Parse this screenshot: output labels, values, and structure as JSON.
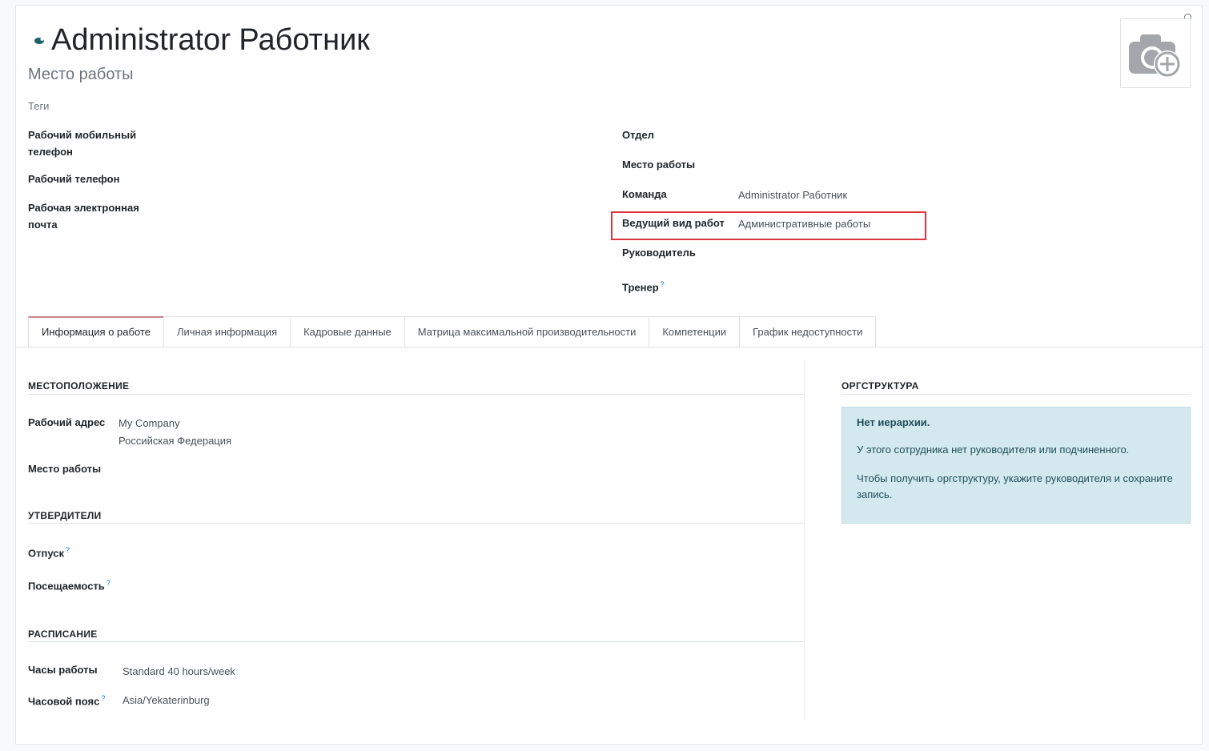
{
  "header": {
    "name": "Administrator Работник",
    "job_title_placeholder": "Место работы",
    "tags_placeholder": "Теги"
  },
  "left_fields": [
    {
      "label": "Рабочий мобильный телефон",
      "value": ""
    },
    {
      "label": "Рабочий телефон",
      "value": ""
    },
    {
      "label": "Рабочая электронная почта",
      "value": ""
    }
  ],
  "right_fields": {
    "department": {
      "label": "Отдел",
      "value": ""
    },
    "job_position": {
      "label": "Место работы",
      "value": ""
    },
    "team": {
      "label": "Команда",
      "value": "Administrator Работник"
    },
    "lead_activity": {
      "label": "Ведущий вид работ",
      "value": "Административные работы"
    },
    "manager": {
      "label": "Руководитель",
      "value": ""
    },
    "coach": {
      "label": "Тренер",
      "value": "",
      "help": "?"
    }
  },
  "tabs": [
    {
      "label": "Информация о работе",
      "active": true
    },
    {
      "label": "Личная информация",
      "active": false
    },
    {
      "label": "Кадровые данные",
      "active": false
    },
    {
      "label": "Матрица максимальной производительности",
      "active": false
    },
    {
      "label": "Компетенции",
      "active": false
    },
    {
      "label": "График недоступности",
      "active": false
    }
  ],
  "location_section": {
    "title": "МЕСТОПОЛОЖЕНИЕ",
    "work_address_label": "Рабочий адрес",
    "work_address_line1": "My Company",
    "work_address_line2": "Российская Федерация",
    "work_location_label": "Место работы"
  },
  "approvers_section": {
    "title": "УТВЕРДИТЕЛИ",
    "time_off_label": "Отпуск",
    "attendance_label": "Посещаемость",
    "help": "?"
  },
  "schedule_section": {
    "title": "РАСПИСАНИЕ",
    "working_hours_label": "Часы работы",
    "working_hours_value": "Standard 40 hours/week",
    "timezone_label": "Часовой пояс",
    "timezone_value": "Asia/Yekaterinburg",
    "help": "?"
  },
  "org_chart": {
    "title": "ОРГСТРУКТУРА",
    "alert_title": "Нет иерархии.",
    "alert_line1": "У этого сотрудника нет руководителя или подчиненного.",
    "alert_line2": "Чтобы получить оргструктуру, укажите руководителя и сохраните запись."
  },
  "colors": {
    "highlight": "#d9363e",
    "alert_bg": "#d3e9ef",
    "active_tab_accent": "#c9868e"
  }
}
